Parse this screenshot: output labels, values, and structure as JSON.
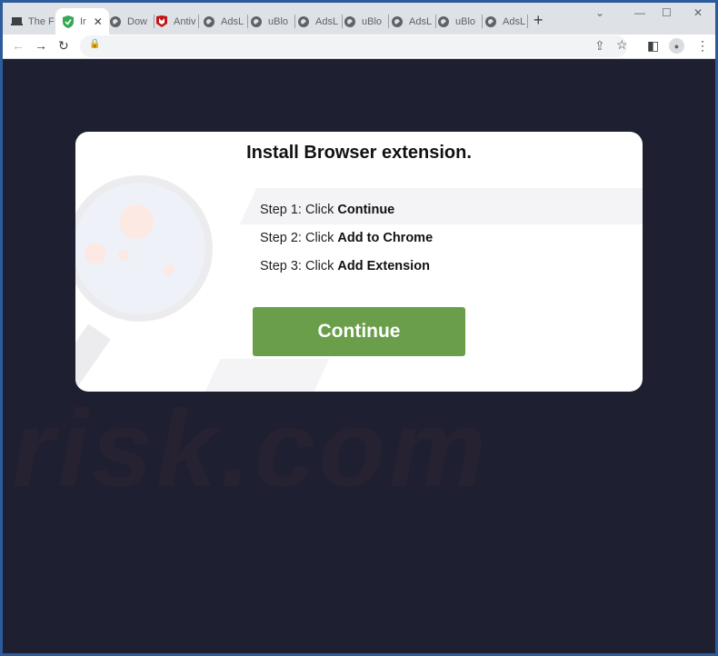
{
  "tabs": [
    {
      "title": "The F",
      "icon": "laptop-icon"
    },
    {
      "title": "Ir",
      "icon": "shield-check-icon",
      "active": true
    },
    {
      "title": "Dow",
      "icon": "globe-icon"
    },
    {
      "title": "Antiv",
      "icon": "mcafee-icon"
    },
    {
      "title": "AdsL",
      "icon": "globe-icon"
    },
    {
      "title": "uBlo",
      "icon": "globe-icon"
    },
    {
      "title": "AdsL",
      "icon": "globe-icon"
    },
    {
      "title": "uBlo",
      "icon": "globe-icon"
    },
    {
      "title": "AdsL",
      "icon": "globe-icon"
    },
    {
      "title": "uBlo",
      "icon": "globe-icon"
    },
    {
      "title": "AdsL",
      "icon": "globe-icon"
    }
  ],
  "icons": {
    "new_tab": "+",
    "close": "✕",
    "back": "←",
    "forward": "→",
    "reload": "↻",
    "lock": "🔒",
    "share": "⇪",
    "star": "☆",
    "side_panel": "◧",
    "profile": "●",
    "menu": "⋮",
    "tab_search": "⌄",
    "minimize": "—",
    "maximize": "☐",
    "window_close": "✕"
  },
  "dialog": {
    "title": "Install Browser extension.",
    "steps": [
      {
        "prefix": "Step 1: Click ",
        "action": "Continue"
      },
      {
        "prefix": "Step 2: Click ",
        "action": "Add to Chrome"
      },
      {
        "prefix": "Step 3: Click ",
        "action": "Add Extension"
      }
    ],
    "button_label": "Continue"
  },
  "watermark": {
    "text": "risk.com"
  },
  "colors": {
    "page_bg": "#1e1f30",
    "button": "#6a9e4b",
    "window_border": "#2c5a9a"
  }
}
